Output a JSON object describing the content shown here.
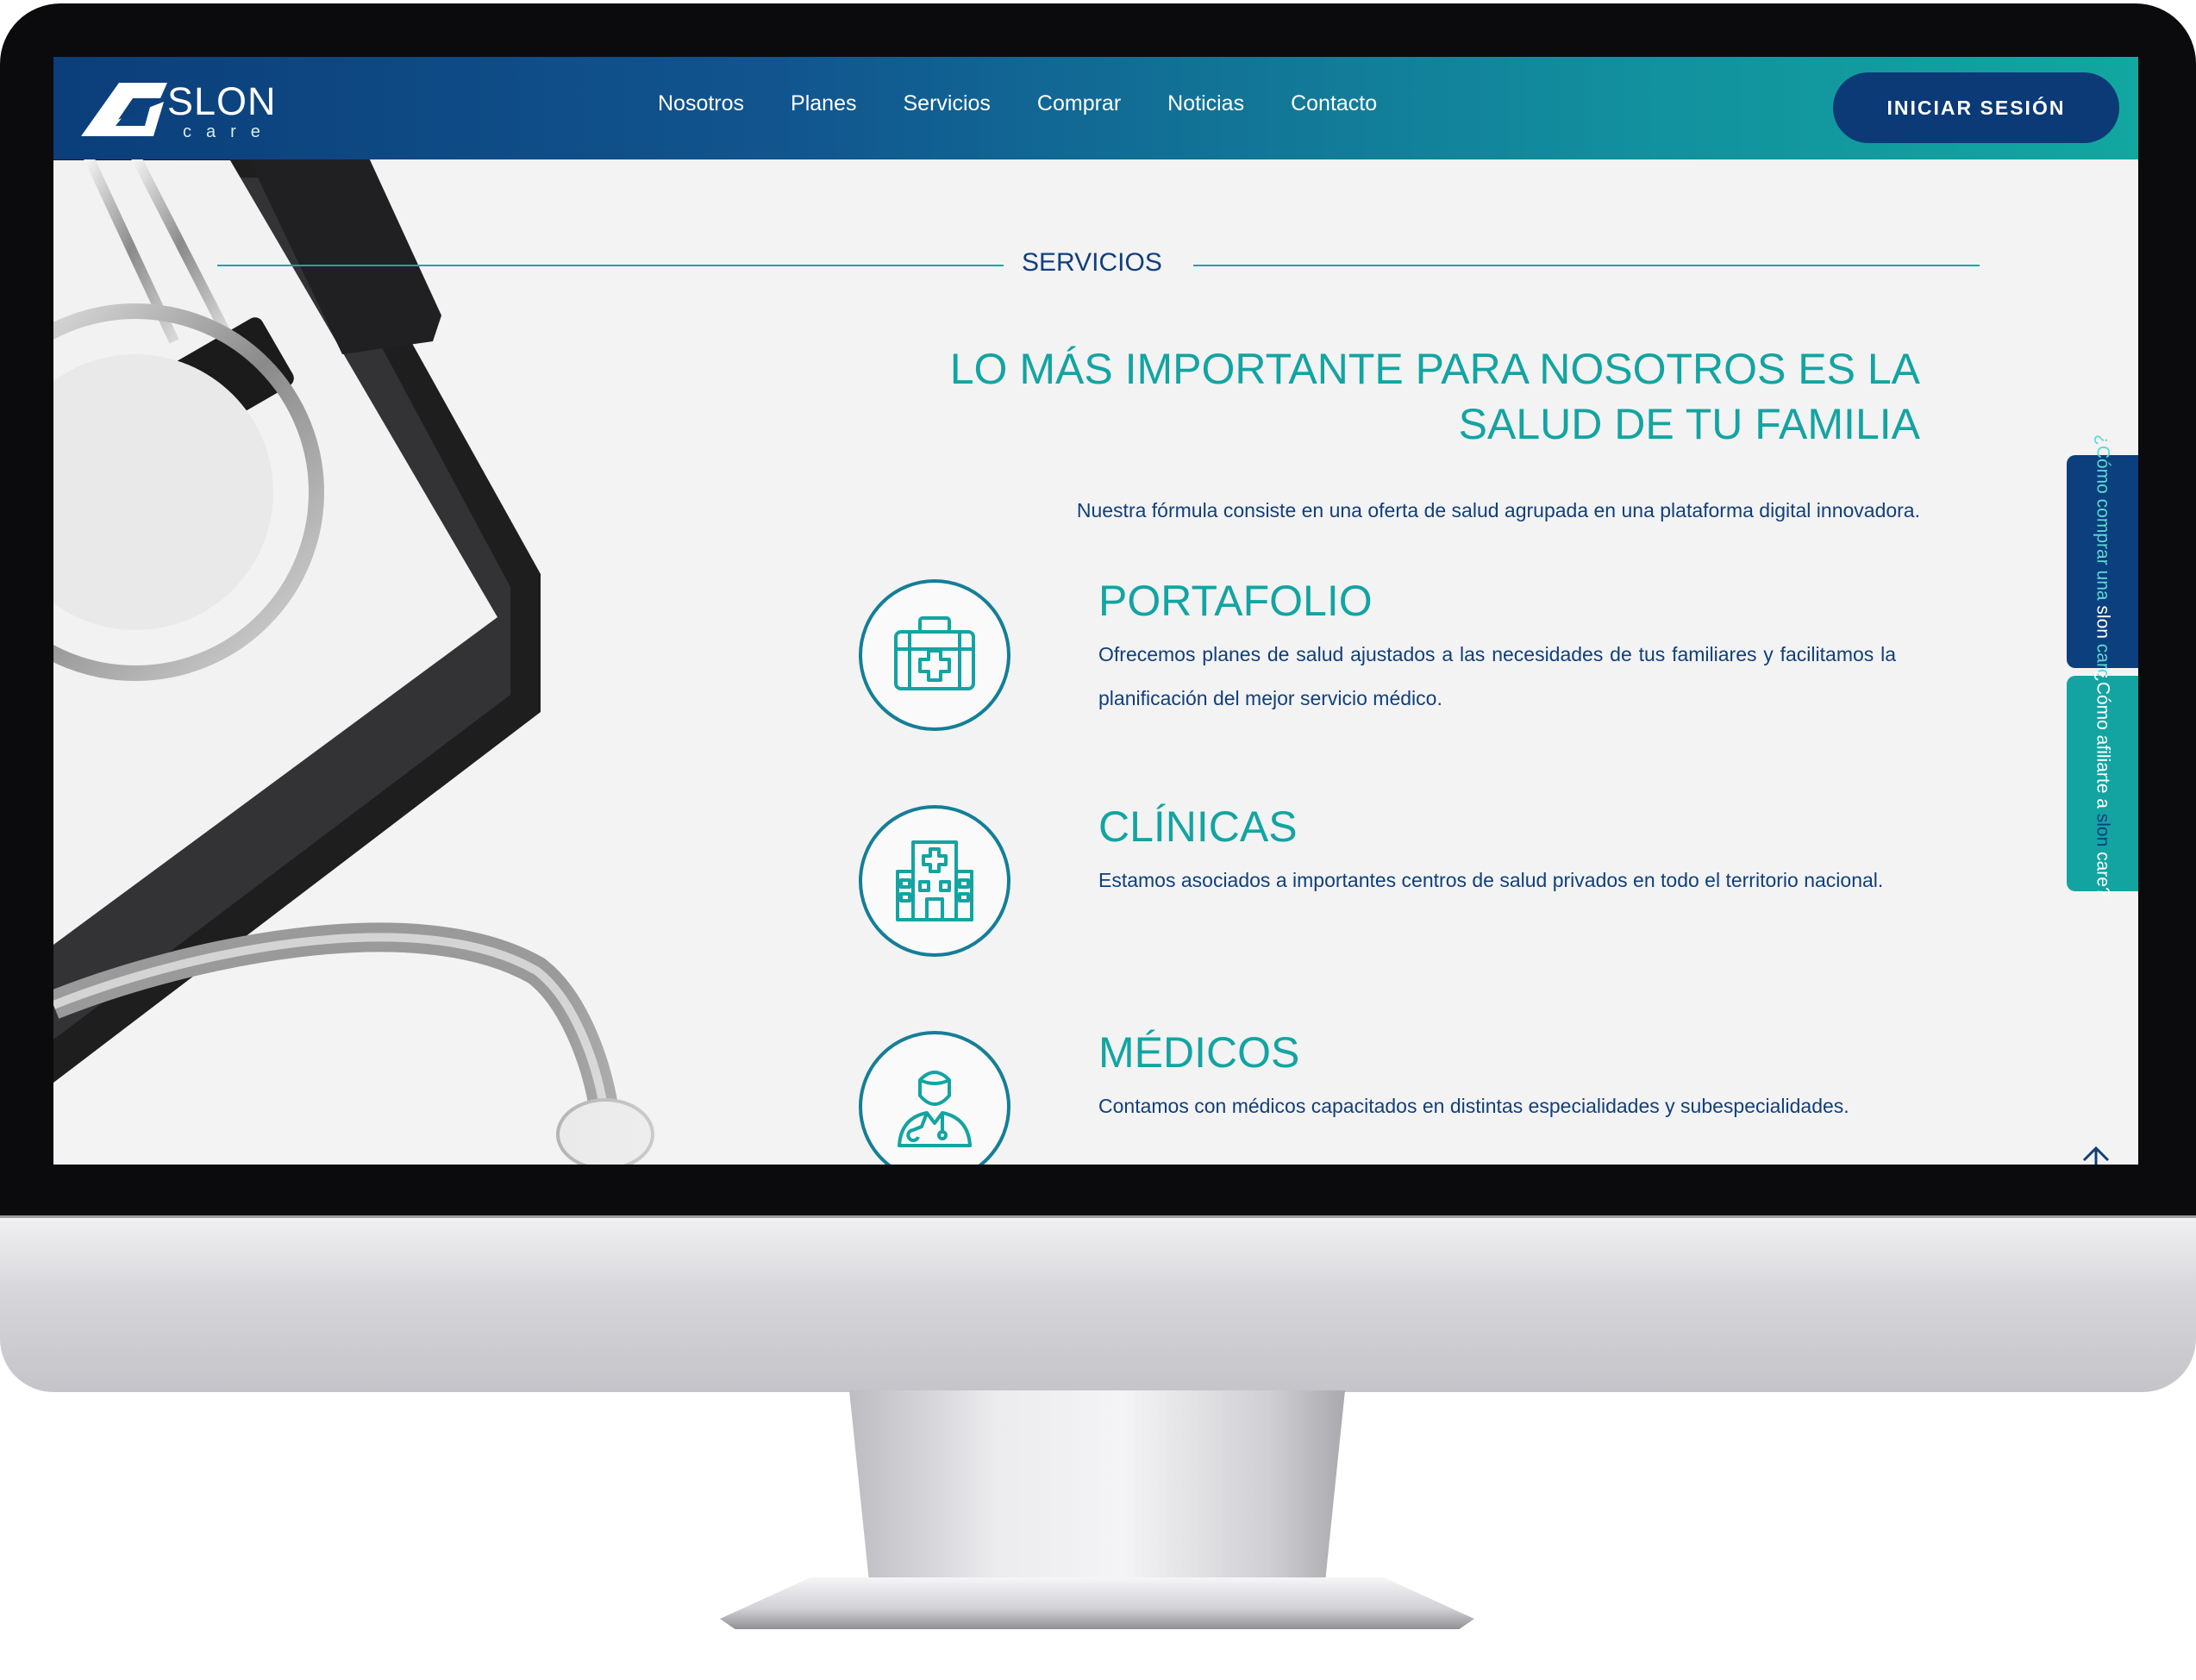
{
  "header": {
    "logo": {
      "name": "SLON",
      "sub": "care"
    },
    "nav": [
      {
        "label": "Nosotros"
      },
      {
        "label": "Planes"
      },
      {
        "label": "Servicios"
      },
      {
        "label": "Comprar"
      },
      {
        "label": "Noticias"
      },
      {
        "label": "Contacto"
      }
    ],
    "login_label": "INICIAR SESIÓN"
  },
  "section": {
    "title": "SERVICIOS",
    "headline_line1": "LO MÁS IMPORTANTE PARA NOSOTROS ES LA",
    "headline_line2": "SALUD DE TU FAMILIA",
    "intro": "Nuestra fórmula consiste en una oferta de salud agrupada en una plataforma digital innovadora."
  },
  "services": [
    {
      "icon": "first-aid-kit-icon",
      "title": "PORTAFOLIO",
      "description": "Ofrecemos planes de salud ajustados a las necesidades de tus familiares y facilitamos la planificación del mejor servicio médico."
    },
    {
      "icon": "hospital-building-icon",
      "title": "CLÍNICAS",
      "description": "Estamos asociados a importantes centros de salud privados en todo el territorio nacional."
    },
    {
      "icon": "doctor-icon",
      "title": "MÉDICOS",
      "description": "Contamos con médicos capacitados en distintas especialidades y subespecialidades."
    }
  ],
  "side_tabs": {
    "buy": {
      "pre": "¿Cómo comprar una",
      "hl": "slon",
      "post": "card?"
    },
    "affiliate": {
      "pre": "¿Cómo afiliarte a",
      "hl": "slon",
      "post": "care?"
    }
  },
  "colors": {
    "navy": "#103f7d",
    "teal": "#13a4a2",
    "header_gradient_start": "#0b3e7a",
    "header_gradient_end": "#12a7a0"
  }
}
